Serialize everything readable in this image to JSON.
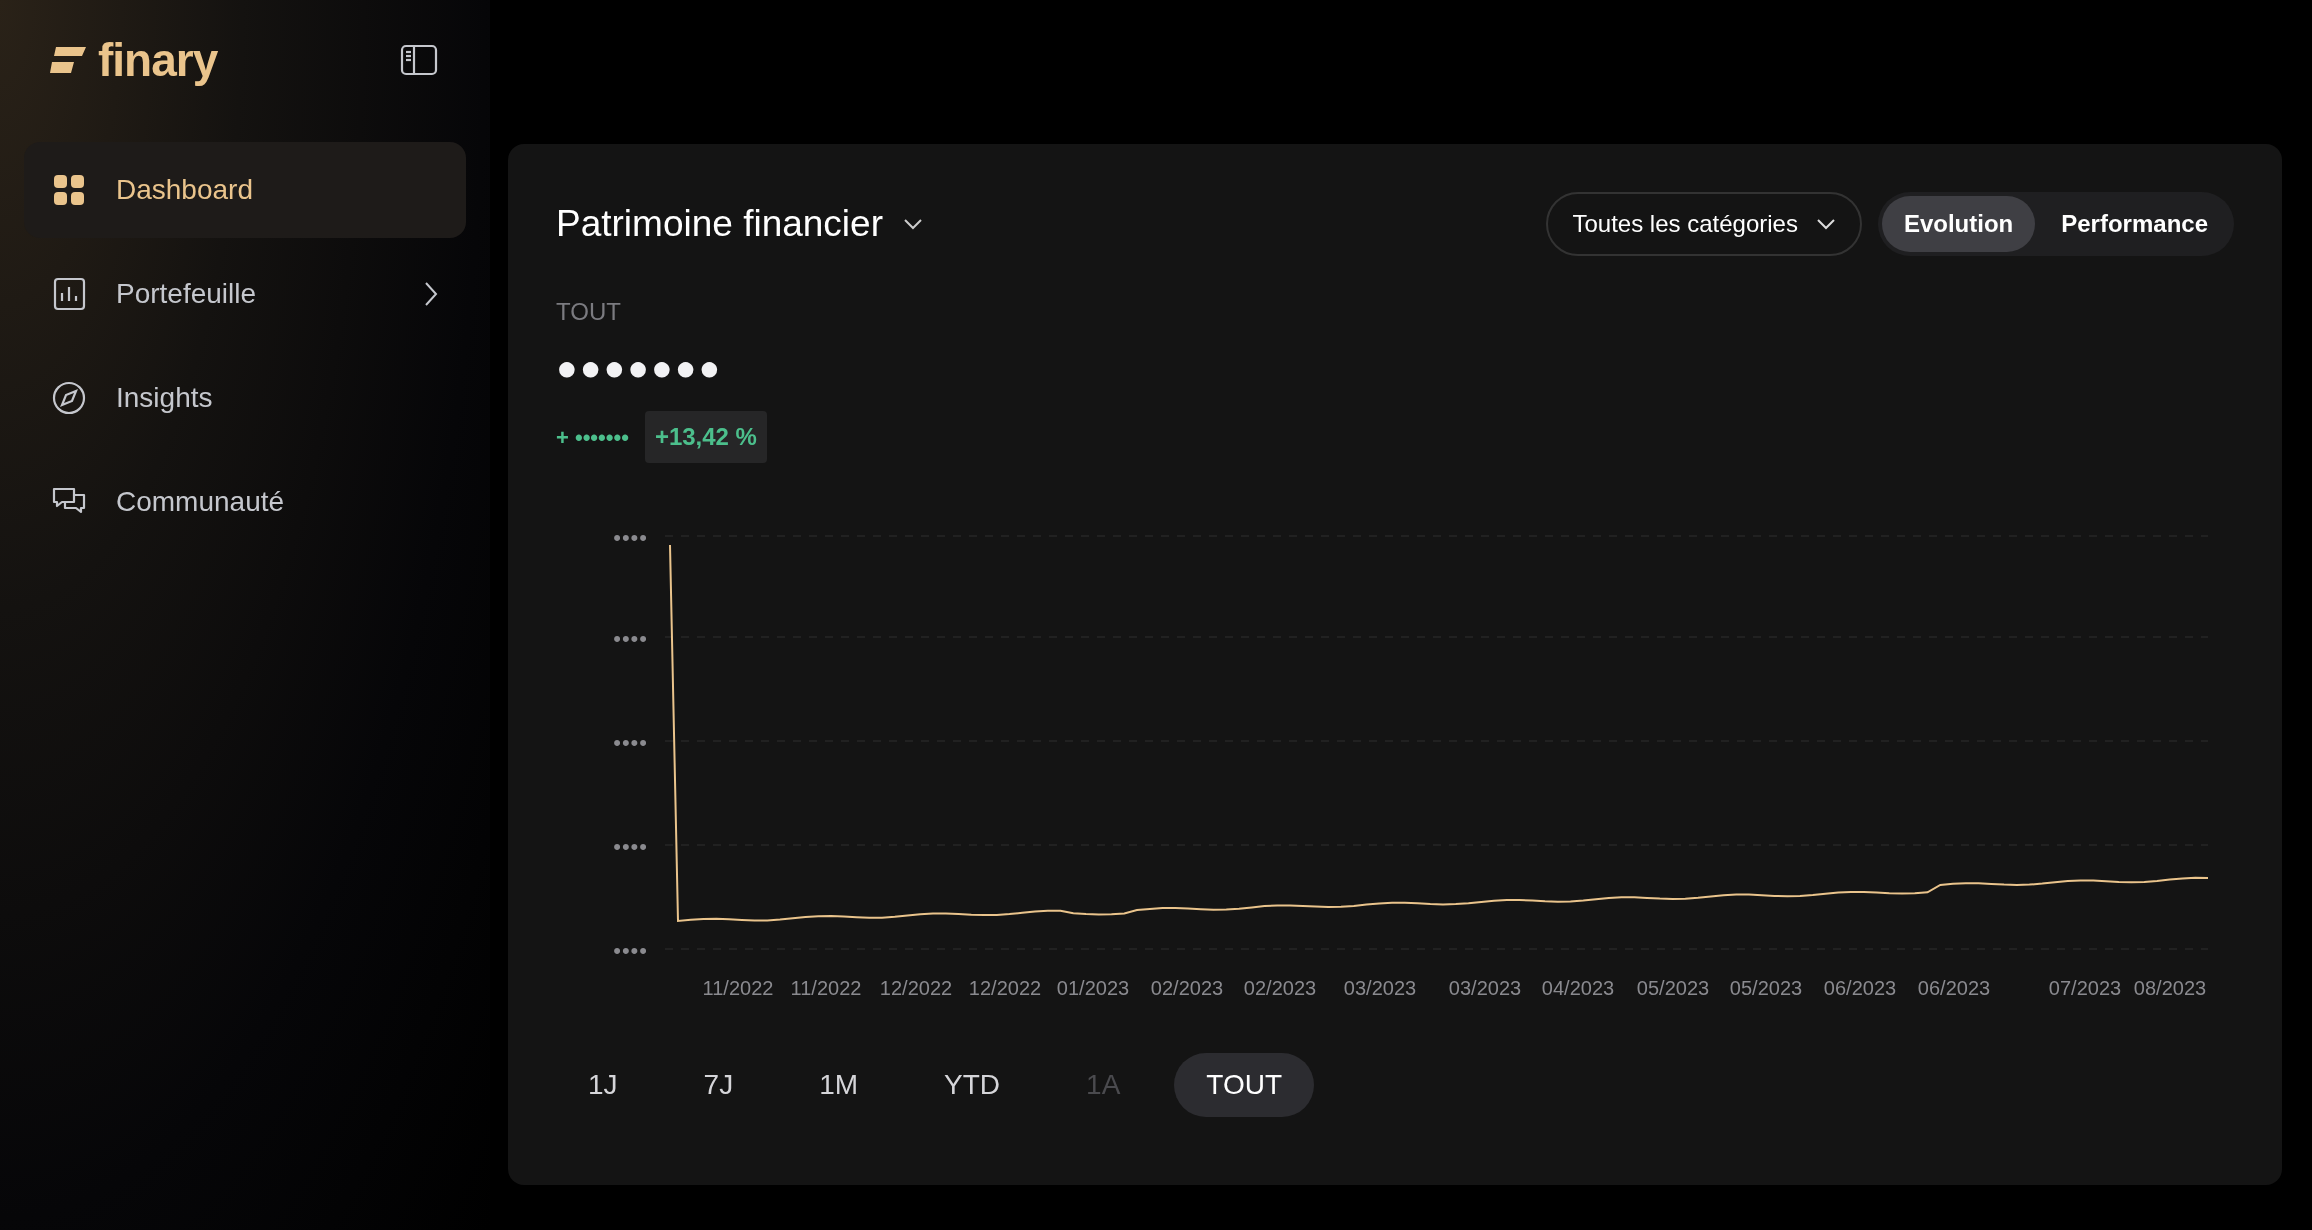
{
  "sidebar": {
    "logo": "finary",
    "items": [
      {
        "label": "Dashboard",
        "kind": "grid",
        "selected": true,
        "submenu": false
      },
      {
        "label": "Portefeuille",
        "kind": "bars",
        "selected": false,
        "submenu": true
      },
      {
        "label": "Insights",
        "kind": "compass",
        "selected": false,
        "submenu": false
      },
      {
        "label": "Communauté",
        "kind": "chat",
        "selected": false,
        "submenu": false
      }
    ]
  },
  "card": {
    "title": "Patrimoine financier",
    "category_filter": "Toutes les catégories",
    "views": [
      {
        "label": "Evolution",
        "selected": true
      },
      {
        "label": "Performance",
        "selected": false
      }
    ],
    "period_label": "TOUT",
    "value": "●●●●●●●",
    "change": "+ •••••••",
    "change_percent": "+13,42 %",
    "chart": {
      "y_labels": [
        "••••",
        "••••",
        "••••",
        "••••",
        "••••"
      ],
      "x_labels": [
        "11/2022",
        "11/2022",
        "12/2022",
        "12/2022",
        "01/2023",
        "02/2023",
        "02/2023",
        "03/2023",
        "03/2023",
        "04/2023",
        "05/2023",
        "05/2023",
        "06/2023",
        "06/2023",
        "07/2023",
        "08/2023"
      ]
    },
    "periods": [
      {
        "label": "1J",
        "selected": false,
        "disabled": false
      },
      {
        "label": "7J",
        "selected": false,
        "disabled": false
      },
      {
        "label": "1M",
        "selected": false,
        "disabled": false
      },
      {
        "label": "YTD",
        "selected": false,
        "disabled": false
      },
      {
        "label": "1A",
        "selected": false,
        "disabled": true
      },
      {
        "label": "TOUT",
        "selected": true,
        "disabled": false
      }
    ]
  }
}
